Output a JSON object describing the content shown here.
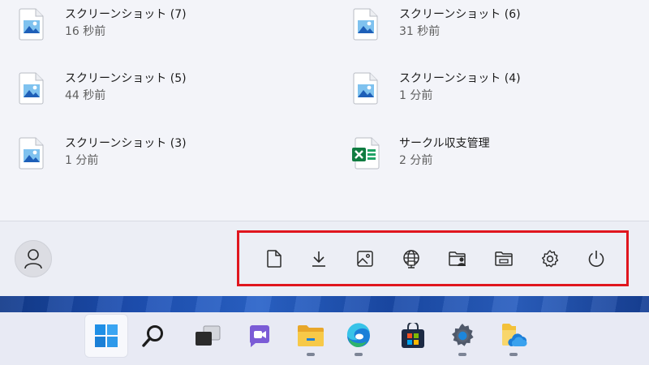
{
  "recommended": {
    "items": [
      {
        "name": "スクリーンショット (7)",
        "time": "16 秒前",
        "icon": "image-file-icon"
      },
      {
        "name": "スクリーンショット (6)",
        "time": "31 秒前",
        "icon": "image-file-icon"
      },
      {
        "name": "スクリーンショット (5)",
        "time": "44 秒前",
        "icon": "image-file-icon"
      },
      {
        "name": "スクリーンショット (4)",
        "time": "1 分前",
        "icon": "image-file-icon"
      },
      {
        "name": "スクリーンショット (3)",
        "time": "1 分前",
        "icon": "image-file-icon"
      },
      {
        "name": "サークル収支管理",
        "time": "2 分前",
        "icon": "excel-file-icon"
      }
    ]
  },
  "footer": {
    "user_icon": "user-avatar-icon",
    "pinned_folders": [
      {
        "icon": "document-icon"
      },
      {
        "icon": "download-icon"
      },
      {
        "icon": "picture-icon"
      },
      {
        "icon": "network-icon"
      },
      {
        "icon": "user-folder-icon"
      },
      {
        "icon": "file-explorer-icon"
      },
      {
        "icon": "settings-icon"
      },
      {
        "icon": "power-icon"
      }
    ],
    "highlight_color": "#e0161e"
  },
  "taskbar": {
    "apps": [
      {
        "icon": "start-icon",
        "running": false,
        "active": true
      },
      {
        "icon": "search-icon",
        "running": false,
        "active": false
      },
      {
        "icon": "task-view-icon",
        "running": false,
        "active": false
      },
      {
        "icon": "teams-chat-icon",
        "running": false,
        "active": false
      },
      {
        "icon": "file-explorer-icon",
        "running": true,
        "active": false
      },
      {
        "icon": "edge-icon",
        "running": true,
        "active": false
      },
      {
        "icon": "store-icon",
        "running": false,
        "active": false
      },
      {
        "icon": "settings-icon",
        "running": true,
        "active": false
      },
      {
        "icon": "onedrive-folder-icon",
        "running": true,
        "active": false
      }
    ]
  }
}
